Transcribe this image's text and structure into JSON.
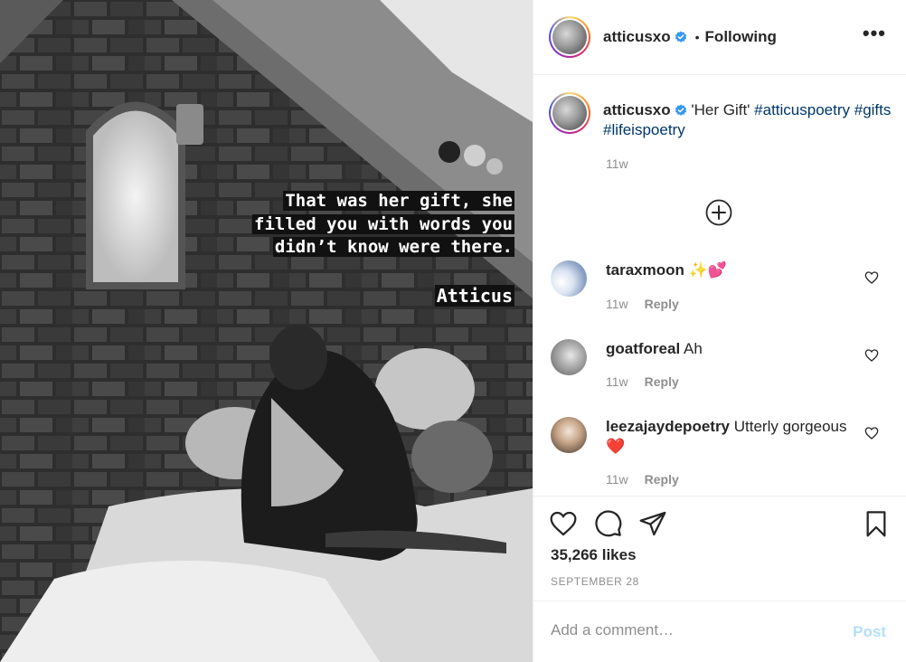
{
  "photo": {
    "quote_lines": [
      "That was her gift, she",
      "filled you with words you",
      "didn’t know were there."
    ],
    "author": "Atticus"
  },
  "header": {
    "username": "atticusxo",
    "separator": "•",
    "follow_status": "Following",
    "more_icon": "more-horizontal-icon"
  },
  "caption": {
    "username": "atticusxo",
    "text": "'Her Gift'",
    "hashtags": [
      "#atticuspoetry",
      "#gifts",
      "#lifeispoetry"
    ],
    "time": "11w"
  },
  "comments": [
    {
      "username": "taraxmoon",
      "text": "✨💕",
      "time": "11w",
      "reply": "Reply"
    },
    {
      "username": "goatforeal",
      "text": "Ah",
      "time": "11w",
      "reply": "Reply"
    },
    {
      "username": "leezajaydepoetry",
      "text": "Utterly gorgeous ❤️",
      "time": "11w",
      "reply": "Reply"
    }
  ],
  "actions": {
    "likes": "35,266 likes",
    "date": "SEPTEMBER 28"
  },
  "add_comment": {
    "placeholder": "Add a comment…",
    "post_label": "Post"
  },
  "colors": {
    "hashtag": "#00376b",
    "verified": "#3897f0",
    "muted": "#8e8e8e",
    "post_disabled": "#b2dffc",
    "heart_red": "#ed4956"
  }
}
